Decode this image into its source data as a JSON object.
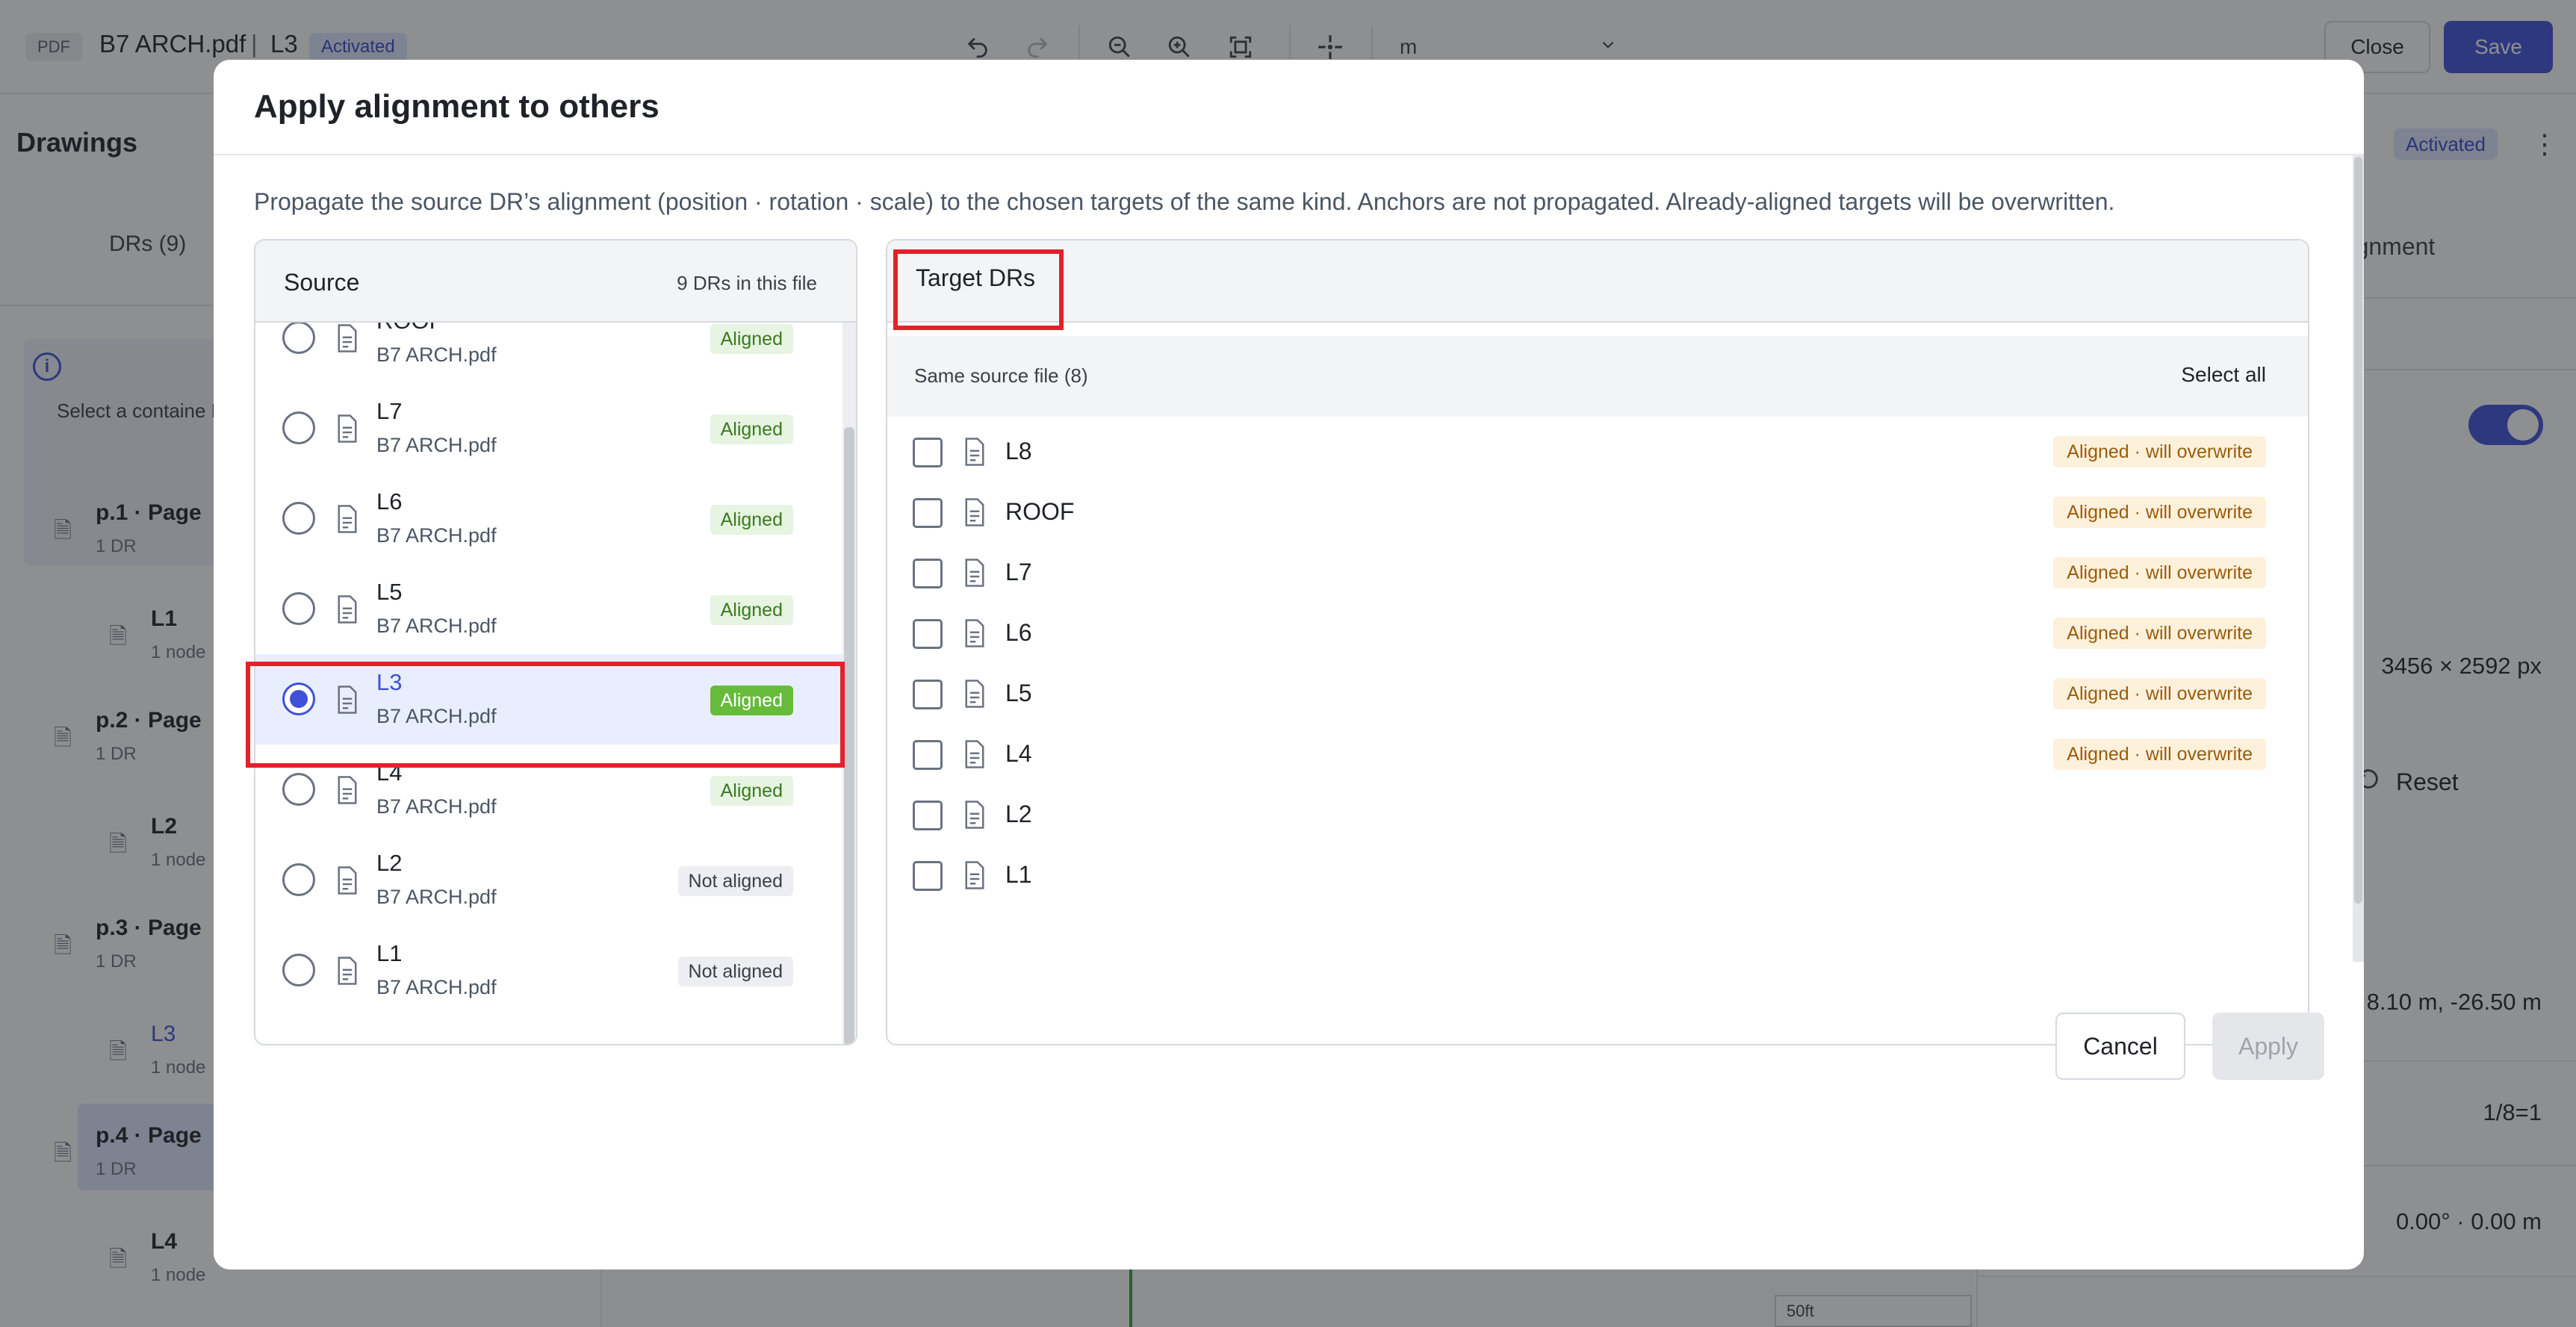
{
  "topbar": {
    "file_type": "PDF",
    "file_name": "B7 ARCH.pdf",
    "separator": "|",
    "drawing": "L3",
    "status_badge": "Activated",
    "unit_value": "m",
    "close_label": "Close",
    "save_label": "Save",
    "tools": [
      "undo-icon",
      "redo-icon",
      "zoom-out-icon",
      "zoom-in-icon",
      "fit-screen-icon",
      "crosshair-icon"
    ]
  },
  "left_panel": {
    "title": "Drawings",
    "tab_label": "DRs (9)",
    "info_text": "Select a containe DR.",
    "pages": [
      {
        "label": "p.1 · Page",
        "sub": "1 DR",
        "leaf": "L1",
        "leaf_sub": "1 node"
      },
      {
        "label": "p.2 · Page",
        "sub": "1 DR",
        "leaf": "L2",
        "leaf_sub": "1 node"
      },
      {
        "label": "p.3 · Page",
        "sub": "1 DR",
        "leaf": "L3",
        "leaf_sub": "1 node"
      },
      {
        "label": "p.4 · Page",
        "sub": "1 DR",
        "leaf": "L4",
        "leaf_sub": "1 node"
      }
    ]
  },
  "canvas": {
    "scale_label": "50ft"
  },
  "right_panel": {
    "status_badge": "Activated",
    "tab_label": "Alignment",
    "dimensions": "3456 × 2592 px",
    "reset_label": "Reset",
    "position": "8.10 m, -26.50 m",
    "scale": "1/8=1",
    "rotation": "0.00° · 0.00 m"
  },
  "modal": {
    "title": "Apply alignment to others",
    "description": "Propagate the source DR’s alignment (position · rotation · scale) to the chosen targets of the same kind. Anchors are not propagated. Already-aligned targets will be overwritten.",
    "cancel_label": "Cancel",
    "apply_label": "Apply",
    "source": {
      "title": "Source",
      "count_label": "9 DRs in this file",
      "items": [
        {
          "name": "ROOF",
          "file": "B7 ARCH.pdf",
          "status": "Aligned",
          "selected": false
        },
        {
          "name": "L7",
          "file": "B7 ARCH.pdf",
          "status": "Aligned",
          "selected": false
        },
        {
          "name": "L6",
          "file": "B7 ARCH.pdf",
          "status": "Aligned",
          "selected": false
        },
        {
          "name": "L5",
          "file": "B7 ARCH.pdf",
          "status": "Aligned",
          "selected": false
        },
        {
          "name": "L3",
          "file": "B7 ARCH.pdf",
          "status": "Aligned",
          "selected": true
        },
        {
          "name": "L4",
          "file": "B7 ARCH.pdf",
          "status": "Aligned",
          "selected": false
        },
        {
          "name": "L2",
          "file": "B7 ARCH.pdf",
          "status": "Not aligned",
          "selected": false
        },
        {
          "name": "L1",
          "file": "B7 ARCH.pdf",
          "status": "Not aligned",
          "selected": false
        }
      ]
    },
    "target": {
      "title": "Target DRs",
      "group_title": "Same source file (8)",
      "select_all_label": "Select all",
      "items": [
        {
          "name": "L8",
          "status": "Aligned · will overwrite",
          "checked": false
        },
        {
          "name": "ROOF",
          "status": "Aligned · will overwrite",
          "checked": false
        },
        {
          "name": "L7",
          "status": "Aligned · will overwrite",
          "checked": false
        },
        {
          "name": "L6",
          "status": "Aligned · will overwrite",
          "checked": false
        },
        {
          "name": "L5",
          "status": "Aligned · will overwrite",
          "checked": false
        },
        {
          "name": "L4",
          "status": "Aligned · will overwrite",
          "checked": false
        },
        {
          "name": "L2",
          "status": "",
          "checked": false
        },
        {
          "name": "L1",
          "status": "",
          "checked": false
        }
      ]
    }
  },
  "colors": {
    "accent": "#3f51d9",
    "aligned_badge": "#66bb3a",
    "overwrite_badge_bg": "#fdf1dc",
    "highlight": "#e3212b"
  }
}
